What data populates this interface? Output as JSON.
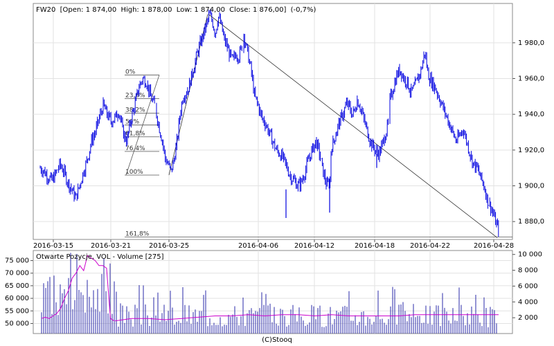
{
  "chart_data": [
    {
      "type": "candlestick",
      "symbol": "FW20",
      "header": {
        "symbol": "FW20",
        "open_label": "Open:",
        "open": "1 874,00",
        "high_label": "High:",
        "high": "1 878,00",
        "low_label": "Low:",
        "low": "1 874,00",
        "close_label": "Close:",
        "close": "1 876,00",
        "change": "(-0,7%)"
      },
      "x_tick_labels": [
        "2016-03-15",
        "2016-03-21",
        "2016-03-25",
        "2016-04-06",
        "2016-04-12",
        "2016-04-18",
        "2016-04-22",
        "2016-04-28"
      ],
      "y_tick_labels": [
        "1 880,0",
        "1 900,0",
        "1 920,0",
        "1 940,0",
        "1 960,0",
        "1 980,0"
      ],
      "y_ticks": [
        1880,
        1900,
        1920,
        1940,
        1960,
        1980
      ],
      "ylim": [
        1870,
        2002
      ],
      "grid": true,
      "trend_line": {
        "from": {
          "x": "2016-03-25",
          "y": 1996
        },
        "to": {
          "x": "2016-04-28",
          "y": 1871
        }
      },
      "fibonacci": {
        "levels": [
          "0%",
          "23,6%",
          "38,2%",
          "50%",
          "61,8%",
          "76,4%",
          "100%",
          "161,8%"
        ],
        "high": 1962,
        "low": 1906
      },
      "price_path": [
        [
          1910,
          1908,
          1905,
          1903,
          1907,
          1912,
          1908,
          1902,
          1898,
          1893,
          1900,
          1908,
          1915,
          1925,
          1930,
          1938,
          1945,
          1940,
          1936,
          1938,
          1942,
          1930,
          1925,
          1937,
          1945,
          1955,
          1960,
          1958,
          1950,
          1945
        ],
        [
          1940,
          1932,
          1925,
          1915,
          1912,
          1908,
          1915,
          1925,
          1940,
          1950,
          1952,
          1955,
          1962,
          1968,
          1975,
          1980,
          1985,
          1990,
          1996,
          1992,
          1985,
          1995,
          1990,
          1982,
          1978,
          1973,
          1970,
          1974,
          1972,
          1978
        ],
        [
          1985,
          1975,
          1965,
          1950,
          1945,
          1938,
          1935,
          1930,
          1925,
          1920,
          1918,
          1915,
          1910,
          1905,
          1903,
          1900,
          1902,
          1908,
          1915,
          1920,
          1925,
          1918,
          1908,
          1900,
          1903
        ],
        [
          1920,
          1925,
          1930,
          1935,
          1938,
          1942,
          1946,
          1944,
          1940,
          1942,
          1948,
          1945,
          1940,
          1935,
          1930,
          1925,
          1922,
          1920,
          1918,
          1920,
          1925,
          1930,
          1935
        ],
        [
          1948,
          1955,
          1962,
          1965,
          1960,
          1958,
          1952,
          1955,
          1960,
          1965,
          1975,
          1962,
          1958,
          1955,
          1950,
          1945,
          1940,
          1935,
          1930,
          1925,
          1928,
          1932,
          1925,
          1918,
          1912,
          1910,
          1905,
          1900,
          1892,
          1888,
          1882,
          1876
        ]
      ],
      "secondary": {
        "title": "Otwarte Pozycje, VOL - Volume [275]",
        "left_tick_labels": [
          "50 000",
          "55 000",
          "60 000",
          "65 000",
          "70 000",
          "75 000"
        ],
        "left_ticks": [
          50000,
          55000,
          60000,
          65000,
          70000,
          75000
        ],
        "left_lim": [
          46000,
          79000
        ],
        "right_tick_labels": [
          "2 000",
          "4 000",
          "6 000",
          "8 000",
          "10 000"
        ],
        "right_ticks": [
          2000,
          4000,
          6000,
          8000,
          10000
        ],
        "right_lim": [
          0,
          10500
        ],
        "open_interest_path": [
          [
            52000,
            52500,
            52000,
            53000,
            54000,
            56000,
            60000,
            63000,
            68000,
            70000,
            73000,
            71000,
            77000,
            76000,
            75000,
            73000,
            73000,
            72000,
            52000,
            51000
          ],
          [
            51000,
            52000,
            52000,
            51500,
            52000,
            52500,
            53000,
            53000,
            53500,
            53000,
            53500,
            53500,
            53000,
            53500,
            53000,
            53000,
            53000,
            53000,
            53500,
            53500,
            53500,
            53500,
            53500,
            53500
          ]
        ],
        "volume_pattern": [
          4000,
          6000,
          9000,
          5000,
          3000,
          8000,
          4000,
          7000,
          6000,
          3000,
          5000,
          4000,
          2500,
          6000,
          3500,
          4500
        ]
      },
      "footer": "(C)Stooq"
    }
  ]
}
